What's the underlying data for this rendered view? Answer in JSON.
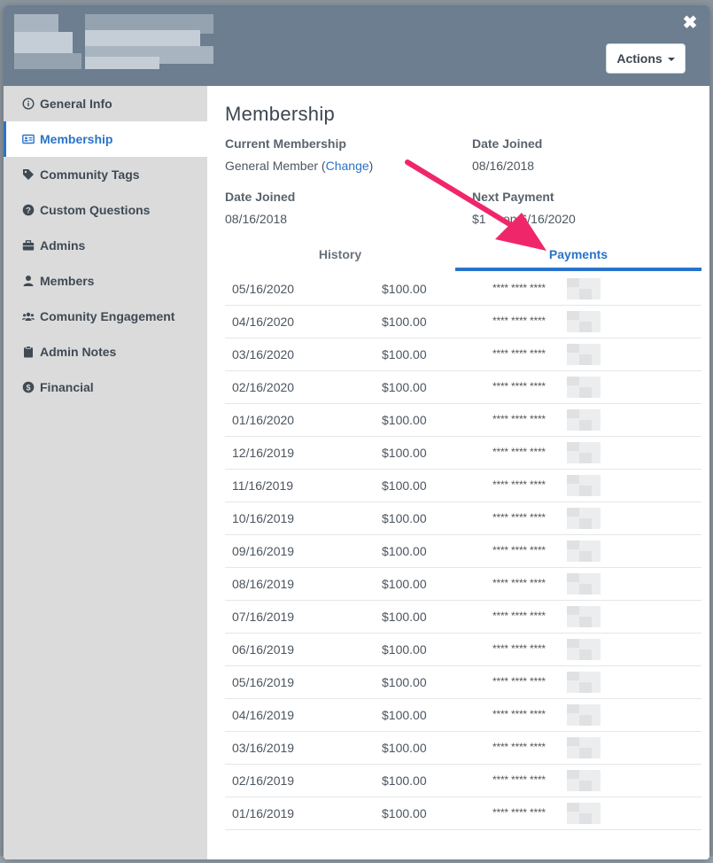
{
  "modal": {
    "actions_label": "Actions",
    "close_icon": "close-icon"
  },
  "sidebar": {
    "items": [
      {
        "label": "General Info",
        "icon": "info-icon"
      },
      {
        "label": "Membership",
        "icon": "id-card-icon"
      },
      {
        "label": "Community Tags",
        "icon": "tag-icon"
      },
      {
        "label": "Custom Questions",
        "icon": "question-icon"
      },
      {
        "label": "Admins",
        "icon": "briefcase-icon"
      },
      {
        "label": "Members",
        "icon": "user-icon"
      },
      {
        "label": "Comunity Engagement",
        "icon": "users-icon"
      },
      {
        "label": "Admin Notes",
        "icon": "clipboard-icon"
      },
      {
        "label": "Financial",
        "icon": "dollar-icon"
      }
    ],
    "active": "Membership"
  },
  "membership": {
    "title": "Membership",
    "current_membership_label": "Current Membership",
    "current_membership_value": "General Member (",
    "change_link": "Change",
    "current_membership_suffix": ")",
    "date_joined_label_1": "Date Joined",
    "date_joined_value_1": "08/16/2018",
    "date_joined_label_2": "Date Joined",
    "date_joined_value_2": "08/16/2018",
    "next_payment_label": "Next Payment",
    "next_payment_value": "$1     on 6/16/2020"
  },
  "tabs": {
    "history": "History",
    "payments": "Payments",
    "active": "Payments"
  },
  "payments": [
    {
      "date": "05/16/2020",
      "amount": "$100.00",
      "card": "**** **** ****"
    },
    {
      "date": "04/16/2020",
      "amount": "$100.00",
      "card": "**** **** ****"
    },
    {
      "date": "03/16/2020",
      "amount": "$100.00",
      "card": "**** **** ****"
    },
    {
      "date": "02/16/2020",
      "amount": "$100.00",
      "card": "**** **** ****"
    },
    {
      "date": "01/16/2020",
      "amount": "$100.00",
      "card": "**** **** ****"
    },
    {
      "date": "12/16/2019",
      "amount": "$100.00",
      "card": "**** **** ****"
    },
    {
      "date": "11/16/2019",
      "amount": "$100.00",
      "card": "**** **** ****"
    },
    {
      "date": "10/16/2019",
      "amount": "$100.00",
      "card": "**** **** ****"
    },
    {
      "date": "09/16/2019",
      "amount": "$100.00",
      "card": "**** **** ****"
    },
    {
      "date": "08/16/2019",
      "amount": "$100.00",
      "card": "**** **** ****"
    },
    {
      "date": "07/16/2019",
      "amount": "$100.00",
      "card": "**** **** ****"
    },
    {
      "date": "06/16/2019",
      "amount": "$100.00",
      "card": "**** **** ****"
    },
    {
      "date": "05/16/2019",
      "amount": "$100.00",
      "card": "**** **** ****"
    },
    {
      "date": "04/16/2019",
      "amount": "$100.00",
      "card": "**** **** ****"
    },
    {
      "date": "03/16/2019",
      "amount": "$100.00",
      "card": "**** **** ****"
    },
    {
      "date": "02/16/2019",
      "amount": "$100.00",
      "card": "**** **** ****"
    },
    {
      "date": "01/16/2019",
      "amount": "$100.00",
      "card": "**** **** ****"
    }
  ],
  "colors": {
    "accent": "#2a73c9",
    "header": "#6c7e8f",
    "sidebar": "#dbdbdb",
    "annotation_arrow": "#f0266b"
  }
}
